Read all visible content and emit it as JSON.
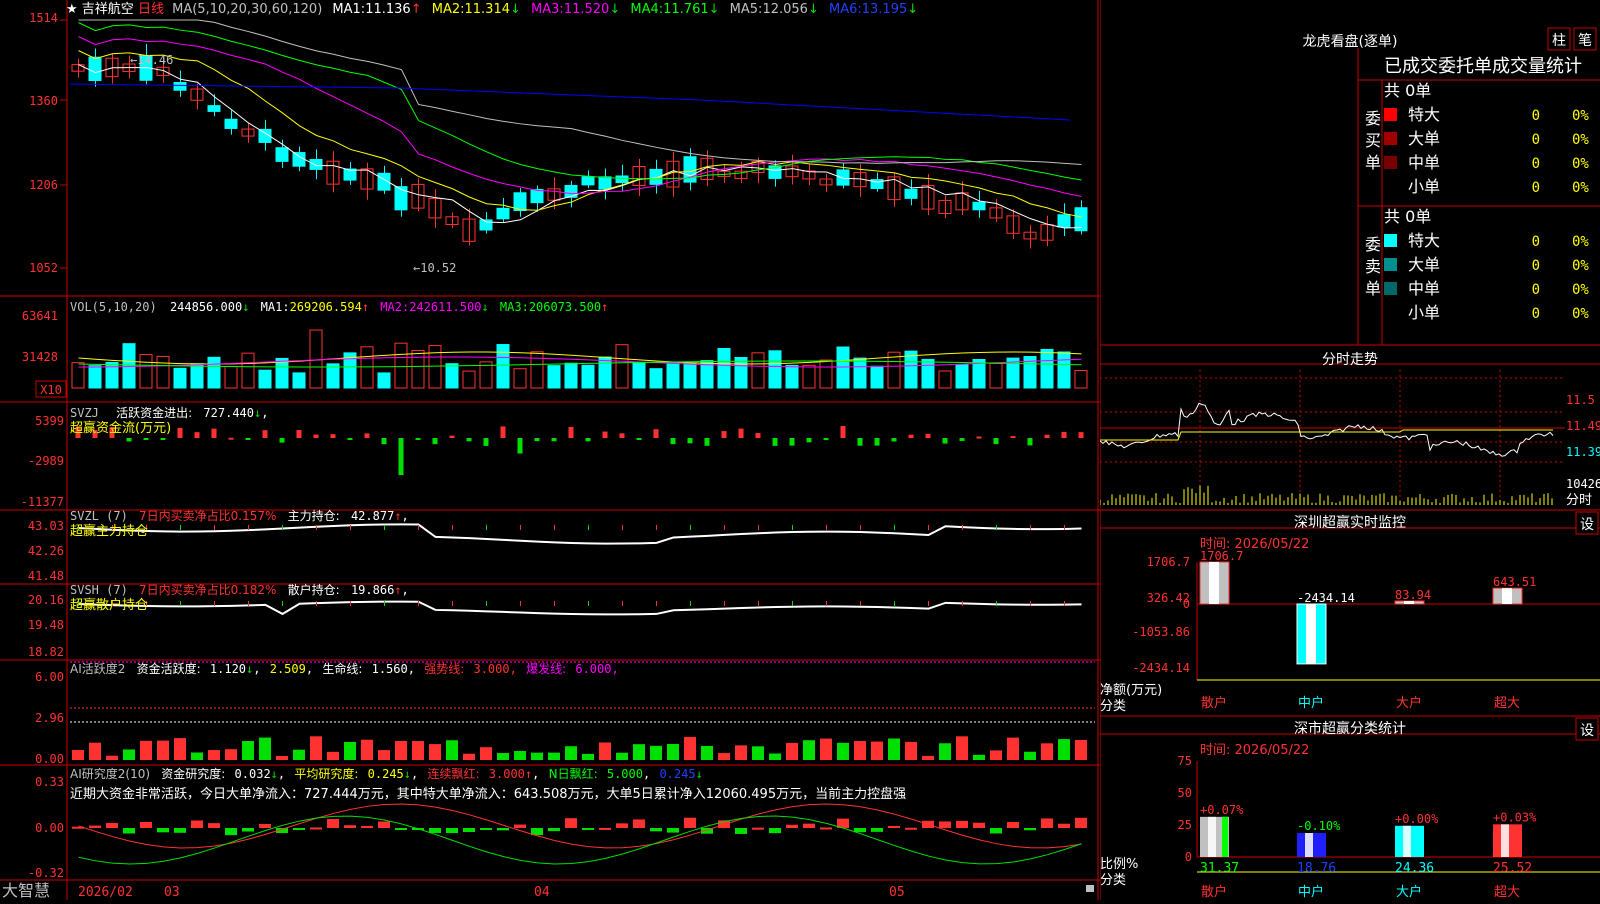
{
  "colors": {
    "up": "#ff3232",
    "down": "#00ffff",
    "grid": "#c80000",
    "ma1": "#ffffff",
    "ma2": "#ffff00",
    "ma3": "#ff00ff",
    "ma4": "#00ff00",
    "ma5": "#c0c0c0",
    "ma6": "#0000ff",
    "label": "#c0c0c0",
    "green": "#00e000"
  },
  "stock": {
    "name": "吉祥航空",
    "period": "日线",
    "star": "★"
  },
  "price_panel": {
    "ma_header": "MA(5,10,20,30,60,120)",
    "ma": [
      {
        "label": "MA1:",
        "value": "11.136",
        "arrow": "↑"
      },
      {
        "label": "MA2:",
        "value": "11.314",
        "arrow": "↓"
      },
      {
        "label": "MA3:",
        "value": "11.520",
        "arrow": "↓"
      },
      {
        "label": "MA4:",
        "value": "11.761",
        "arrow": "↓"
      },
      {
        "label": "MA5:",
        "value": "12.056",
        "arrow": "↓"
      },
      {
        "label": "MA6:",
        "value": "13.195",
        "arrow": "↓"
      }
    ],
    "yticks": [
      "1514",
      "1360",
      "1206",
      "1052"
    ],
    "high_mark": "←14.46",
    "low_mark": "←10.52"
  },
  "vol_panel": {
    "title": "VOL(5,10,20)",
    "value": "244856.000",
    "arrow": "↓",
    "ma": [
      {
        "label": "MA1:",
        "value": "269206.594",
        "arrow": "↑"
      },
      {
        "label": "MA2:",
        "value": "242611.500",
        "arrow": "↓"
      },
      {
        "label": "MA3:",
        "value": "206073.500",
        "arrow": "↑"
      }
    ],
    "yticks": [
      "63641",
      "31428"
    ],
    "unit": "X10"
  },
  "svzj_panel": {
    "title": "SVZJ",
    "label": "活跃资金进出:",
    "value": "727.440",
    "arrow": "↓",
    "subtitle": "超赢资金流(万元)",
    "yticks": [
      "5399",
      "-2989",
      "-11377"
    ]
  },
  "svzl_panel": {
    "title": "SVZL (7)",
    "ratio_label": "7日内买卖净占比0.157%",
    "hold_label": "主力持仓:",
    "hold_value": "42.877",
    "arrow": "↑",
    "subtitle": "超赢主力持仓",
    "yticks": [
      "43.03",
      "42.26",
      "41.48"
    ]
  },
  "svsh_panel": {
    "title": "SVSH (7)",
    "ratio_label": "7日内买卖净占比0.182%",
    "hold_label": "散户持仓:",
    "hold_value": "19.866",
    "arrow": "↑",
    "subtitle": "超赢散户持仓",
    "yticks": [
      "20.16",
      "19.48",
      "18.82"
    ]
  },
  "ai_panel": {
    "title": "AI活跃度2",
    "a_label": "资金活跃度:",
    "a_value": "1.120",
    "a_arrow": "↓",
    "b_value": "2.509",
    "c_label": "生命线:",
    "c_value": "1.560",
    "d_label": "强势线:",
    "d_value": "3.000",
    "e_label": "爆发线:",
    "e_value": "6.000",
    "yticks": [
      "6.00",
      "2.96",
      "0.00"
    ]
  },
  "ai2_panel": {
    "title": "AI研究度2(10)",
    "a_label": "资金研究度:",
    "a_value": "0.032",
    "a_arrow": "↓",
    "b_label": "平均研究度:",
    "b_value": "0.245",
    "b_arrow": "↓",
    "c_label": "连续飘红:",
    "c_value": "3.000",
    "c_arrow": "↑",
    "d_label": "N日飘红:",
    "d_value": "5.000",
    "e_value": "0.245",
    "e_arrow": "↓",
    "message": "近期大资金非常活跃，今日大单净流入：727.444万元，其中特大单净流入：643.508万元，大单5日累计净入12060.495万元，当前主力控盘强",
    "yticks": [
      "0.33",
      "0.00",
      "-0.32"
    ]
  },
  "x_axis": {
    "brand": "大智慧",
    "labels": [
      "2026/02",
      "03",
      "04",
      "05"
    ]
  },
  "longhu": {
    "title": "龙虎看盘(逐单)",
    "btn1": "柱",
    "btn2": "笔",
    "tabs": [
      "已成交",
      "委托单",
      "成交量统计"
    ],
    "buy_label": [
      "委",
      "买",
      "单"
    ],
    "sell_label": [
      "委",
      "卖",
      "单"
    ],
    "buy_total": "共 0单",
    "sell_total": "共 0单",
    "buy_rows": [
      {
        "name": "特大",
        "count": "0",
        "pct": "0%",
        "color": "#ff0000"
      },
      {
        "name": "大单",
        "count": "0",
        "pct": "0%",
        "color": "#a00000"
      },
      {
        "name": "中单",
        "count": "0",
        "pct": "0%",
        "color": "#780000"
      },
      {
        "name": "小单",
        "count": "0",
        "pct": "0%",
        "color": ""
      }
    ],
    "sell_rows": [
      {
        "name": "特大",
        "count": "0",
        "pct": "0%",
        "color": "#00ffff"
      },
      {
        "name": "大单",
        "count": "0",
        "pct": "0%",
        "color": "#009090"
      },
      {
        "name": "中单",
        "count": "0",
        "pct": "0%",
        "color": "#006868"
      },
      {
        "name": "小单",
        "count": "0",
        "pct": "0%",
        "color": ""
      }
    ]
  },
  "intraday": {
    "title": "分时走势",
    "yticks": [
      "11.5",
      "11.49",
      "11.39"
    ],
    "vol_label": "10426",
    "vol_sub": "分时"
  },
  "monitor": {
    "title": "深圳超赢实时监控",
    "btn": "设",
    "time": "时间: 2026/05/22",
    "y_label": "净额(万元)",
    "x_label": "分类",
    "chart_data": {
      "type": "bar",
      "categories": [
        "散户",
        "中户",
        "大户",
        "超大"
      ],
      "values": [
        1706.7,
        -2434.14,
        83.94,
        643.51
      ],
      "value_labels": [
        "1706.7",
        "-2434.14",
        "83.94",
        "643.51"
      ],
      "yticks": [
        "1706.7",
        "326.42",
        "0",
        "-1053.86",
        "-2434.14"
      ]
    }
  },
  "classify": {
    "title": "深市超赢分类统计",
    "btn": "设",
    "time": "时间: 2026/05/22",
    "y_label": "比例%",
    "x_label": "分类",
    "chart_data": {
      "type": "bar",
      "categories": [
        "散户",
        "中户",
        "大户",
        "超大"
      ],
      "values": [
        31.37,
        18.76,
        24.36,
        25.52
      ],
      "changes": [
        "+0.07%",
        "-0.10%",
        "+0.00%",
        "+0.03%"
      ],
      "yticks": [
        "75",
        "50",
        "25",
        "0"
      ],
      "ylim": [
        0,
        75
      ]
    }
  }
}
